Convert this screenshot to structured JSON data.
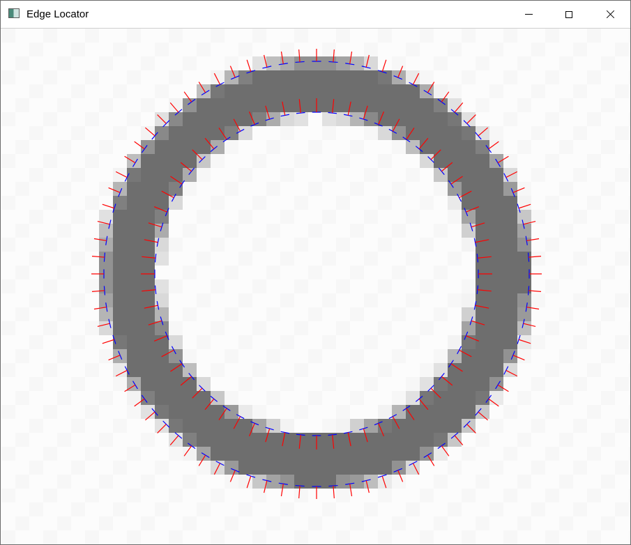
{
  "window": {
    "title": "Edge Locator",
    "icon": "app-icon"
  },
  "titlebar_buttons": [
    {
      "name": "minimize-icon"
    },
    {
      "name": "maximize-icon"
    },
    {
      "name": "close-icon"
    }
  ],
  "colors": {
    "ring_dark": "#6e6e6e",
    "ring_mid": "#a8a8a8",
    "ring_light": "#d7d7d7",
    "edge_line": "#0000ff",
    "normal_line": "#ff0000",
    "background": "#fcfcfc"
  },
  "detected_edges": {
    "outer_edge_samples": 80,
    "inner_edge_samples": 64
  }
}
